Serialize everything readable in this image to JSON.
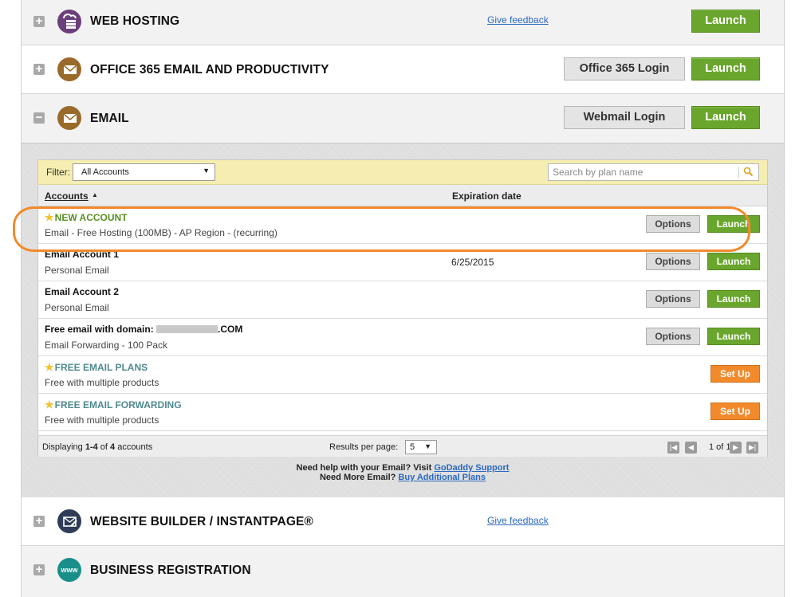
{
  "products": {
    "web_hosting": {
      "title": "WEB HOSTING",
      "feedback": "Give feedback",
      "launch": "Launch"
    },
    "office365": {
      "title": "OFFICE 365 EMAIL AND PRODUCTIVITY",
      "login": "Office 365 Login",
      "launch": "Launch"
    },
    "email": {
      "title": "EMAIL",
      "login": "Webmail Login",
      "launch": "Launch"
    },
    "website_builder": {
      "title": "WEBSITE BUILDER / INSTANTPAGE®",
      "feedback": "Give feedback"
    },
    "business_registration": {
      "title": "BUSINESS REGISTRATION"
    }
  },
  "icons": {
    "toggle_plus": "+",
    "toggle_minus": "−",
    "www": "www"
  },
  "email_panel": {
    "filter_label": "Filter:",
    "filter_value": "All Accounts",
    "search_placeholder": "Search by plan name",
    "col_accounts": "Accounts",
    "col_sort_arrow": "▲",
    "col_expiration": "Expiration date",
    "accounts": [
      {
        "name": "NEW ACCOUNT",
        "sub": "Email - Free Hosting (100MB) - AP Region - (recurring)",
        "expiration": "",
        "options": "Options",
        "launch": "Launch"
      },
      {
        "name": "Email Account 1",
        "sub": "Personal Email",
        "expiration": "6/25/2015",
        "options": "Options",
        "launch": "Launch"
      },
      {
        "name": "Email Account 2",
        "sub": "Personal Email",
        "expiration": "",
        "options": "Options",
        "launch": "Launch"
      },
      {
        "name_prefix": "Free email with domain: ",
        "name_suffix": ".COM",
        "sub": "Email Forwarding - 100 Pack",
        "expiration": "",
        "options": "Options",
        "launch": "Launch"
      },
      {
        "name": "FREE EMAIL PLANS",
        "sub": "Free with multiple products",
        "setup": "Set Up"
      },
      {
        "name": "FREE EMAIL FORWARDING",
        "sub": "Free with multiple products",
        "setup": "Set Up"
      }
    ],
    "footer": {
      "displaying_prefix": "Displaying ",
      "displaying_range": "1-4",
      "displaying_mid": " of ",
      "displaying_total": "4",
      "displaying_suffix": " accounts",
      "results_label": "Results per page:",
      "results_value": "5",
      "page_text": "1 of 1"
    },
    "help_line1": "Need help with your Email? Visit ",
    "help_link1": "GoDaddy Support",
    "help_line2": "Need More Email? ",
    "help_link2": "Buy Additional Plans"
  },
  "colors": {
    "launch_green": "#6aa62d",
    "setup_orange": "#f28a2c",
    "highlight_orange": "#f28a2c",
    "icon_purple": "#6a3f7a",
    "icon_brown": "#9a6a2a",
    "icon_navy": "#2e3c58",
    "icon_teal": "#198f8a"
  }
}
